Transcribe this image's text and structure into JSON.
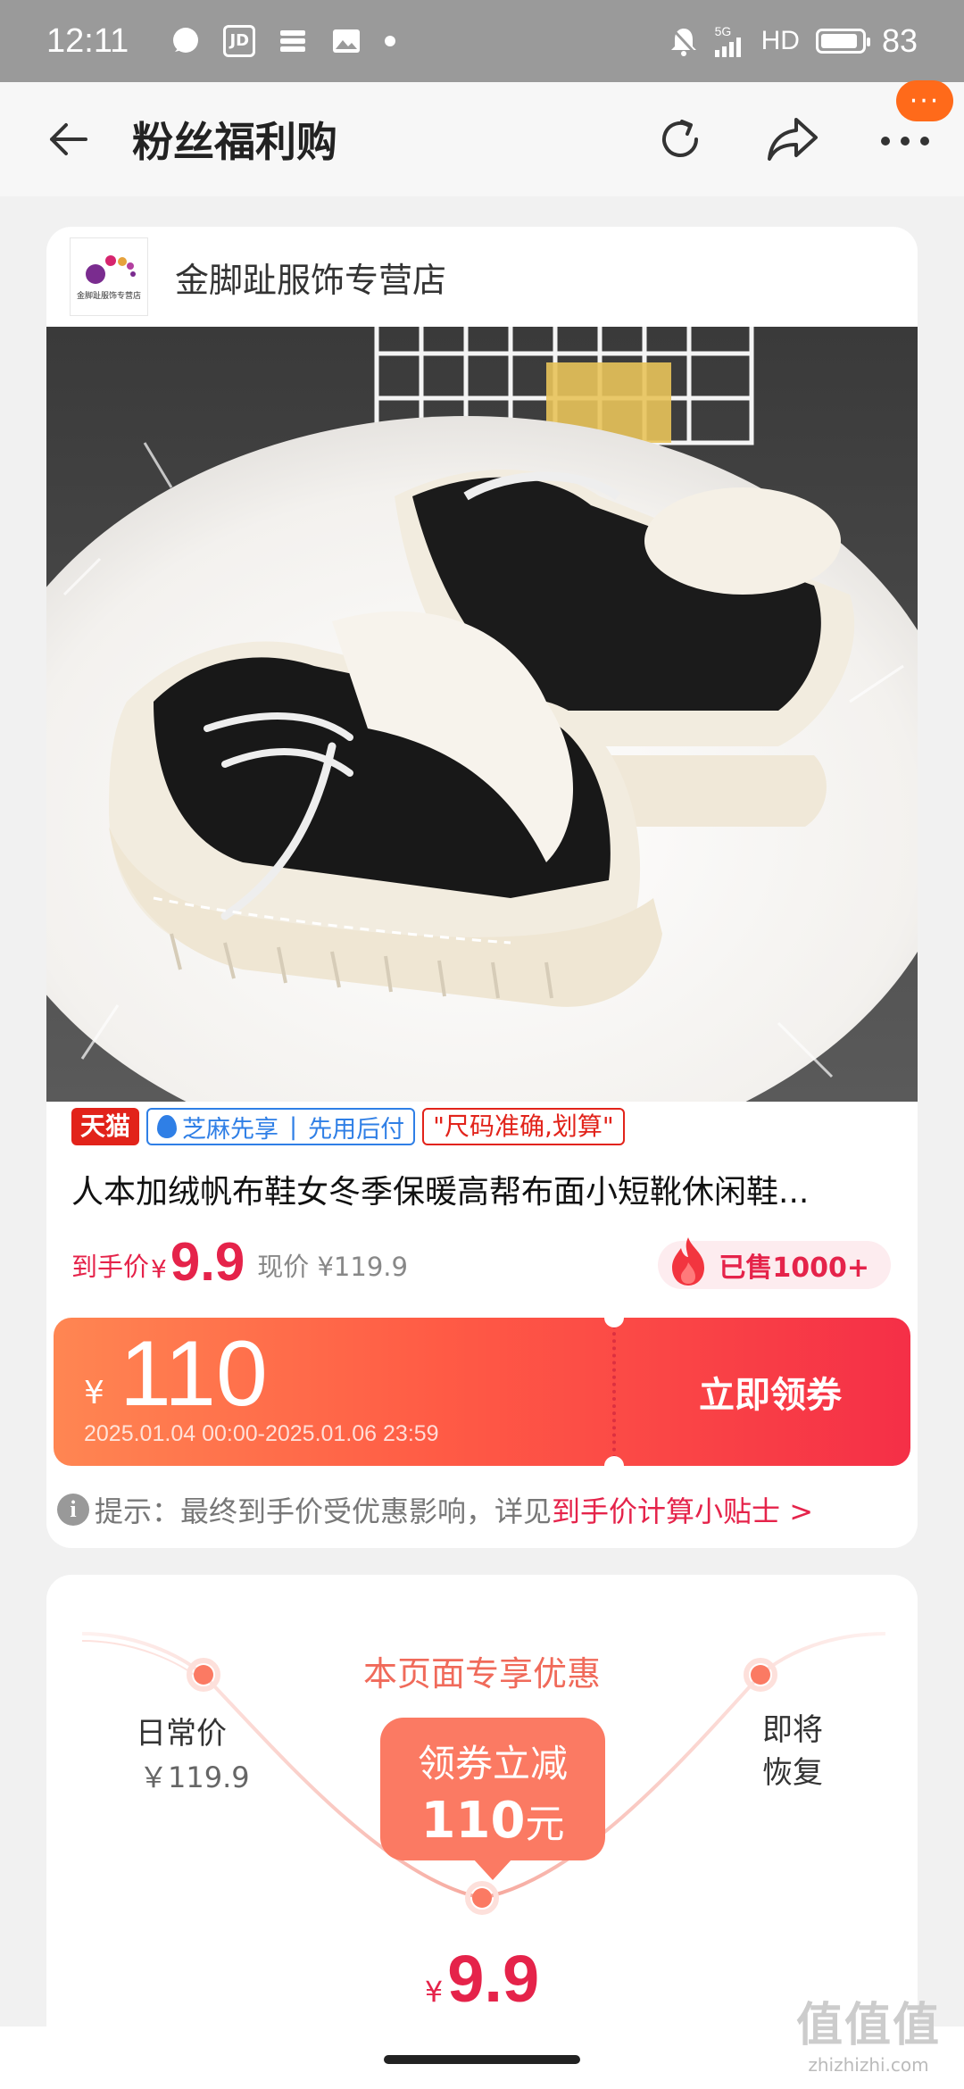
{
  "status_bar": {
    "time": "12:11",
    "left_icons": [
      "chat-bubble-icon",
      "jd-icon",
      "stack-icon",
      "image-icon",
      "dot-icon"
    ],
    "jd_label": "JD",
    "network": "5G",
    "hd": "HD",
    "battery": "83"
  },
  "navbar": {
    "title": "粉丝福利购",
    "more_badge": "···"
  },
  "shop": {
    "name": "金脚趾服饰专营店",
    "logo_text": "金脚趾服饰专营店"
  },
  "product": {
    "tags": {
      "tmall": "天猫",
      "zhima_left": "芝麻先享",
      "zhima_sep": "|",
      "zhima_right": "先用后付",
      "size_note": "\"尺码准确,划算\""
    },
    "title": "人本加绒帆布鞋女冬季保暖高帮布面小短靴休闲鞋...",
    "price_label": "到手价",
    "price_yen": "¥",
    "price_value": "9.9",
    "original_price": "现价 ¥119.9",
    "sold": "已售1000+"
  },
  "coupon": {
    "yen": "¥",
    "amount": "110",
    "valid": "2025.01.04 00:00-2025.01.06 23:59",
    "button": "立即领券"
  },
  "tip": {
    "icon": "i",
    "text": "提示：最终到手价受优惠影响，详见",
    "link": "到手价计算小贴士 >"
  },
  "promo": {
    "title": "本页面专享优惠",
    "left_label": "日常价",
    "left_price": "￥119.9",
    "right_label": "即将恢复",
    "bubble_line1": "领券立减",
    "bubble_amount": "110",
    "bubble_unit": "元",
    "price_yen": "¥",
    "price_value": "9.9"
  },
  "watermark": {
    "main": "值值值",
    "sub": "zhizhizhi.com"
  },
  "colors": {
    "accent_red": "#e5234a",
    "coupon_start": "#ff8652",
    "coupon_end": "#f52f47",
    "badge_orange": "#ff6a1a",
    "promo_orange": "#fb7a63"
  }
}
